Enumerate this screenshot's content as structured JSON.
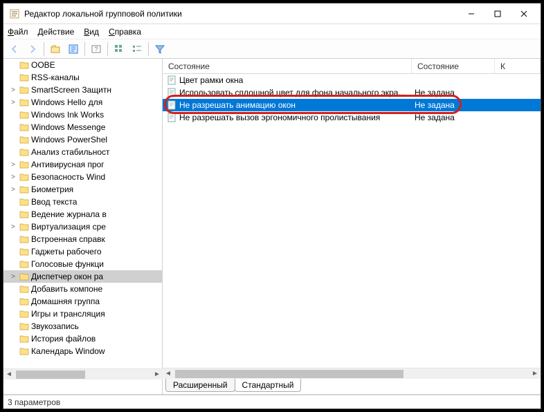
{
  "title": "Редактор локальной групповой политики",
  "menu": {
    "file": "Файл",
    "action": "Действие",
    "view": "Вид",
    "help": "Справка"
  },
  "tree": {
    "items": [
      {
        "label": "OOBE",
        "expander": ""
      },
      {
        "label": "RSS-каналы",
        "expander": ""
      },
      {
        "label": "SmartScreen Защитн",
        "expander": ">"
      },
      {
        "label": "Windows Hello для",
        "expander": ">"
      },
      {
        "label": "Windows Ink Works",
        "expander": ""
      },
      {
        "label": "Windows Messenge",
        "expander": ""
      },
      {
        "label": "Windows PowerShel",
        "expander": ""
      },
      {
        "label": "Анализ стабильност",
        "expander": ""
      },
      {
        "label": "Антивирусная прог",
        "expander": ">"
      },
      {
        "label": "Безопасность Wind",
        "expander": ">"
      },
      {
        "label": "Биометрия",
        "expander": ">"
      },
      {
        "label": "Ввод текста",
        "expander": ""
      },
      {
        "label": "Ведение журнала в",
        "expander": ""
      },
      {
        "label": "Виртуализация сре",
        "expander": ">"
      },
      {
        "label": "Встроенная справк",
        "expander": ""
      },
      {
        "label": "Гаджеты рабочего",
        "expander": ""
      },
      {
        "label": "Голосовые функци",
        "expander": ""
      },
      {
        "label": "Диспетчер окон ра",
        "expander": ">",
        "selected": true
      },
      {
        "label": "Добавить компоне",
        "expander": ""
      },
      {
        "label": "Домашняя группа",
        "expander": ""
      },
      {
        "label": "Игры и трансляция",
        "expander": ""
      },
      {
        "label": "Звукозапись",
        "expander": ""
      },
      {
        "label": "История файлов",
        "expander": ""
      },
      {
        "label": "Календарь Window",
        "expander": ""
      }
    ]
  },
  "columns": {
    "policy": "Состояние",
    "state": "Состояние",
    "comment": "К"
  },
  "rows": [
    {
      "policy": "Цвет рамки окна",
      "state": ""
    },
    {
      "policy": "Использовать сплошной цвет для фона начального экра...",
      "state": "Не задана"
    },
    {
      "policy": "Не разрешать анимацию окон",
      "state": "Не задана",
      "selected": true
    },
    {
      "policy": "Не разрешать вызов эргономичного пролистывания",
      "state": "Не задана"
    }
  ],
  "tabs": {
    "extended": "Расширенный",
    "standard": "Стандартный"
  },
  "status": "3 параметров"
}
